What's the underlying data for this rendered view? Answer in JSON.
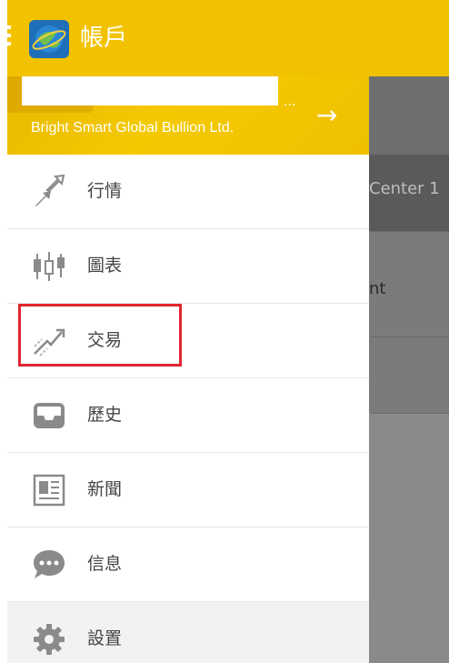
{
  "app_bar": {
    "title": "帳戶"
  },
  "account": {
    "name": "",
    "ellipsis": "...",
    "broker": "Bright Smart Global Bullion Ltd.",
    "arrow": "→"
  },
  "background": {
    "label_center": "Center 1",
    "label_account": "nt"
  },
  "menu": {
    "items": [
      {
        "label": "行情",
        "icon": "quotes-icon"
      },
      {
        "label": "圖表",
        "icon": "chart-candlestick-icon"
      },
      {
        "label": "交易",
        "icon": "trade-icon"
      },
      {
        "label": "歷史",
        "icon": "history-inbox-icon"
      },
      {
        "label": "新聞",
        "icon": "news-icon"
      },
      {
        "label": "信息",
        "icon": "chat-bubble-icon"
      },
      {
        "label": "設置",
        "icon": "gear-icon"
      }
    ]
  },
  "colors": {
    "app_bar": "#f2c200",
    "highlight": "#e0262f",
    "icon_gray": "#9e9e9e"
  }
}
